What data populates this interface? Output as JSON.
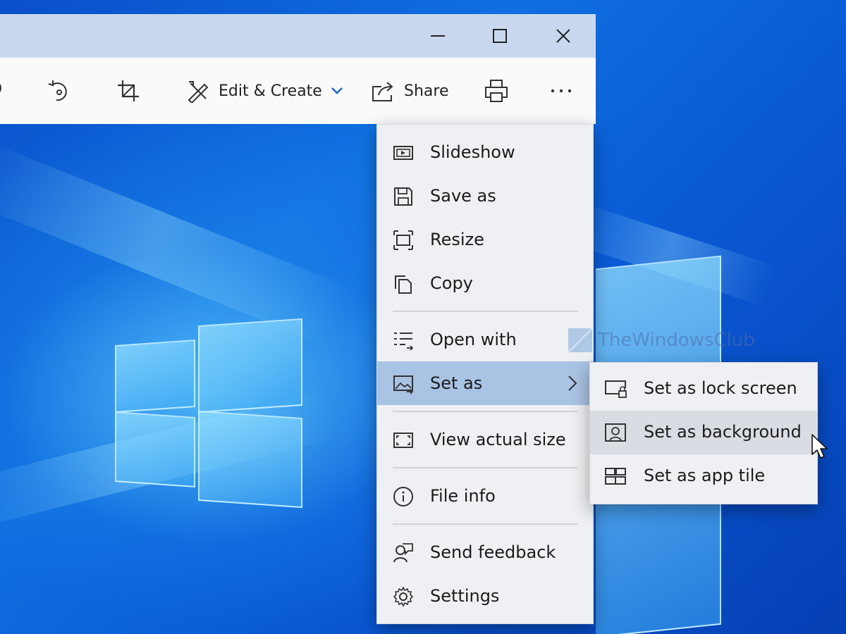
{
  "toolbar": {
    "edit_create_label": "Edit & Create",
    "share_label": "Share"
  },
  "menu": {
    "items": [
      {
        "label": "Slideshow",
        "icon": "slideshow-icon"
      },
      {
        "label": "Save as",
        "icon": "save-icon"
      },
      {
        "label": "Resize",
        "icon": "resize-icon"
      },
      {
        "label": "Copy",
        "icon": "copy-icon"
      },
      {
        "label": "Open with",
        "icon": "open-with-icon"
      },
      {
        "label": "Set as",
        "icon": "set-as-icon",
        "active": true
      },
      {
        "label": "View actual size",
        "icon": "actual-size-icon"
      },
      {
        "label": "File info",
        "icon": "info-icon"
      },
      {
        "label": "Send feedback",
        "icon": "feedback-icon"
      },
      {
        "label": "Settings",
        "icon": "gear-icon"
      }
    ]
  },
  "submenu": {
    "items": [
      {
        "label": "Set as lock screen",
        "icon": "lock-screen-icon"
      },
      {
        "label": "Set as background",
        "icon": "background-icon",
        "hover": true
      },
      {
        "label": "Set as app tile",
        "icon": "app-tile-icon"
      }
    ]
  },
  "watermark": {
    "text": "TheWindowsClub"
  },
  "colors": {
    "titlebar": "#c9d8ee",
    "menu_bg": "#eef0f3",
    "active_item": "#a9c3e4",
    "accent": "#0a64c8"
  }
}
